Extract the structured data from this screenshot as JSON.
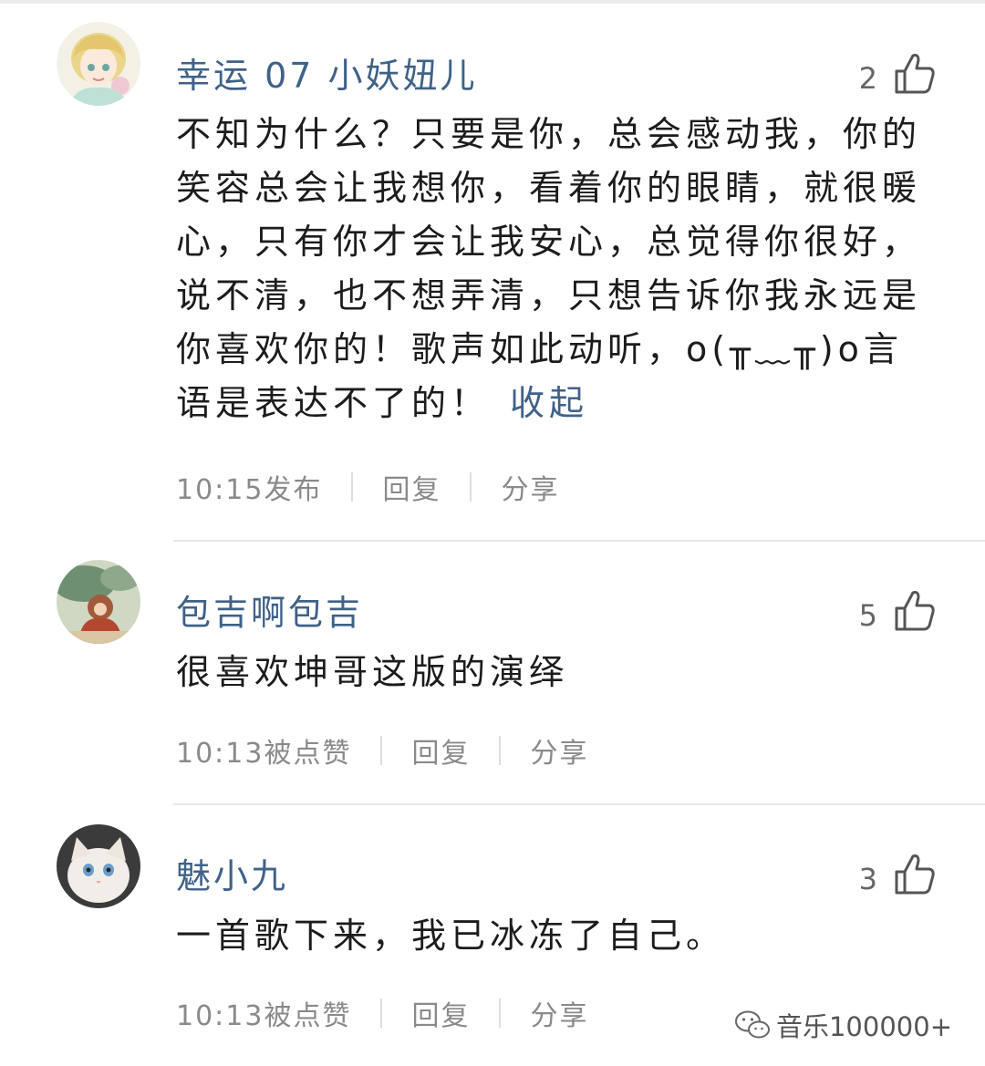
{
  "comments": [
    {
      "username": "幸运 07 小妖妞儿",
      "likes": "2",
      "text": "不知为什么？只要是你，总会感动我，你的笑容总会让我想你，看着你的眼睛，就很暖心，只有你才会让我安心，总觉得你很好，说不清，也不想弄清，只想告诉你我永远是你喜欢你的！歌声如此动听，o(╥﹏╥)o言语是表达不了的！",
      "collapse_label": "收起",
      "time": "10:15发布",
      "reply_label": "回复",
      "share_label": "分享"
    },
    {
      "username": "包吉啊包吉",
      "likes": "5",
      "text": "很喜欢坤哥这版的演绎",
      "time": "10:13被点赞",
      "reply_label": "回复",
      "share_label": "分享"
    },
    {
      "username": "魅小九",
      "likes": "3",
      "text": "一首歌下来，我已冰冻了自己。",
      "time": "10:13被点赞",
      "reply_label": "回复",
      "share_label": "分享"
    }
  ],
  "watermark": {
    "icon": "wechat-icon",
    "text": "音乐100000+"
  },
  "colors": {
    "username": "#3f6288",
    "meta_text": "#8a8a8a",
    "divider": "#e6e6e6"
  }
}
